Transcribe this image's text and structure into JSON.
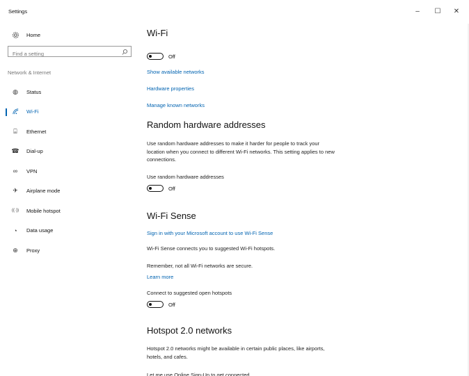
{
  "window": {
    "title": "Settings",
    "minimize_glyph": "–",
    "maximize_glyph": "☐",
    "close_glyph": "✕"
  },
  "sidebar": {
    "home_label": "Home",
    "search_placeholder": "Find a setting",
    "section_header": "Network & Internet",
    "items": [
      {
        "label": "Status",
        "icon": "globe-status-icon",
        "glyph": "◍"
      },
      {
        "label": "Wi-Fi",
        "icon": "wifi-icon",
        "glyph": "◜",
        "active": true
      },
      {
        "label": "Ethernet",
        "icon": "ethernet-icon",
        "glyph": "⌸"
      },
      {
        "label": "Dial-up",
        "icon": "dialup-icon",
        "glyph": "☎"
      },
      {
        "label": "VPN",
        "icon": "vpn-icon",
        "glyph": "∞"
      },
      {
        "label": "Airplane mode",
        "icon": "airplane-icon",
        "glyph": "✈"
      },
      {
        "label": "Mobile hotspot",
        "icon": "hotspot-icon",
        "glyph": "((·))"
      },
      {
        "label": "Data usage",
        "icon": "data-usage-icon",
        "glyph": "◔"
      },
      {
        "label": "Proxy",
        "icon": "proxy-globe-icon",
        "glyph": "⊕"
      }
    ]
  },
  "main": {
    "wifi": {
      "title": "Wi-Fi",
      "toggle_state": "Off",
      "links": [
        "Show available networks",
        "Hardware properties",
        "Manage known networks"
      ]
    },
    "random": {
      "title": "Random hardware addresses",
      "description": "Use random hardware addresses to make it harder for people to track your location when you connect to different Wi-Fi networks. This setting applies to new connections.",
      "toggle_label": "Use random hardware addresses",
      "toggle_state": "Off"
    },
    "sense": {
      "title": "Wi-Fi Sense",
      "signin_link": "Sign in with your Microsoft account to use Wi-Fi Sense",
      "description": "Wi-Fi Sense connects you to suggested Wi-Fi hotspots.",
      "warning": "Remember, not all Wi-Fi networks are secure.",
      "learn_more": "Learn more",
      "toggle_label": "Connect to suggested open hotspots",
      "toggle_state": "Off"
    },
    "hotspot": {
      "title": "Hotspot 2.0 networks",
      "description": "Hotspot 2.0 networks might be available in certain public places, like airports, hotels, and cafes.",
      "cutoff_text": "Let me use Online Sign-Up to get connected"
    }
  },
  "colors": {
    "accent": "#0063b1",
    "text": "#111111",
    "muted": "#777777"
  }
}
